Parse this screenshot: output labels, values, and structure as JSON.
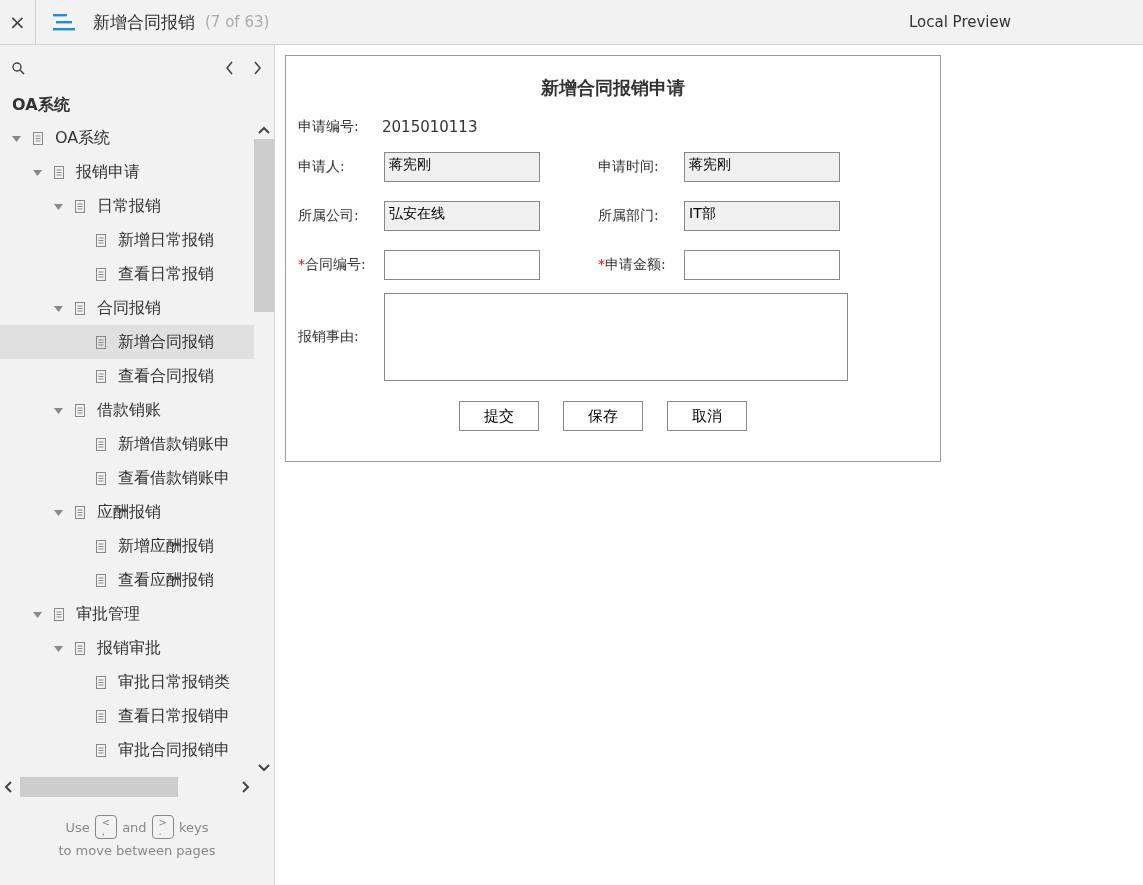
{
  "toolbar": {
    "close": "×",
    "title": "新增合同报销",
    "counter": "(7 of 63)",
    "preview": "Local Preview"
  },
  "sidebar": {
    "heading": "OA系统",
    "tree": [
      {
        "label": "OA系统",
        "expanded": true,
        "selected": false,
        "children": [
          {
            "label": "报销申请",
            "expanded": true,
            "selected": false,
            "children": [
              {
                "label": "日常报销",
                "expanded": true,
                "selected": false,
                "children": [
                  {
                    "label": "新增日常报销",
                    "selected": false
                  },
                  {
                    "label": "查看日常报销",
                    "selected": false
                  }
                ]
              },
              {
                "label": "合同报销",
                "expanded": true,
                "selected": false,
                "children": [
                  {
                    "label": "新增合同报销",
                    "selected": true
                  },
                  {
                    "label": "查看合同报销",
                    "selected": false
                  }
                ]
              },
              {
                "label": "借款销账",
                "expanded": true,
                "selected": false,
                "children": [
                  {
                    "label": "新增借款销账申",
                    "selected": false
                  },
                  {
                    "label": "查看借款销账申",
                    "selected": false
                  }
                ]
              },
              {
                "label": "应酬报销",
                "expanded": true,
                "selected": false,
                "children": [
                  {
                    "label": "新增应酬报销",
                    "selected": false
                  },
                  {
                    "label": "查看应酬报销",
                    "selected": false
                  }
                ]
              }
            ]
          },
          {
            "label": "审批管理",
            "expanded": true,
            "selected": false,
            "children": [
              {
                "label": "报销审批",
                "expanded": true,
                "selected": false,
                "children": [
                  {
                    "label": "审批日常报销类",
                    "selected": false
                  },
                  {
                    "label": "查看日常报销申",
                    "selected": false
                  },
                  {
                    "label": "审批合同报销申",
                    "selected": false
                  }
                ]
              }
            ]
          }
        ]
      }
    ],
    "hint": {
      "use": "Use",
      "key1_top": "<",
      "key1_bottom": ",",
      "and": "and",
      "key2_top": ">",
      "key2_bottom": ".",
      "keys": "keys",
      "line2": "to move between pages"
    }
  },
  "form": {
    "title": "新增合同报销申请",
    "number_label": "申请编号:",
    "number_value": "2015010113",
    "rows": [
      [
        {
          "label": "申请人:",
          "value": "蒋宪刚",
          "readonly": true
        },
        {
          "label": "申请时间:",
          "value": "蒋宪刚",
          "readonly": true
        }
      ],
      [
        {
          "label": "所属公司:",
          "value": "弘安在线",
          "readonly": true
        },
        {
          "label": "所属部门:",
          "value": "IT部",
          "readonly": true
        }
      ],
      [
        {
          "label": "合同编号:",
          "readonly": false,
          "marker": "*"
        },
        {
          "label": "申请金额:",
          "readonly": false,
          "marker": "*"
        }
      ]
    ],
    "reason_label": "报销事由:",
    "buttons": [
      "提交",
      "保存",
      "取消"
    ]
  }
}
